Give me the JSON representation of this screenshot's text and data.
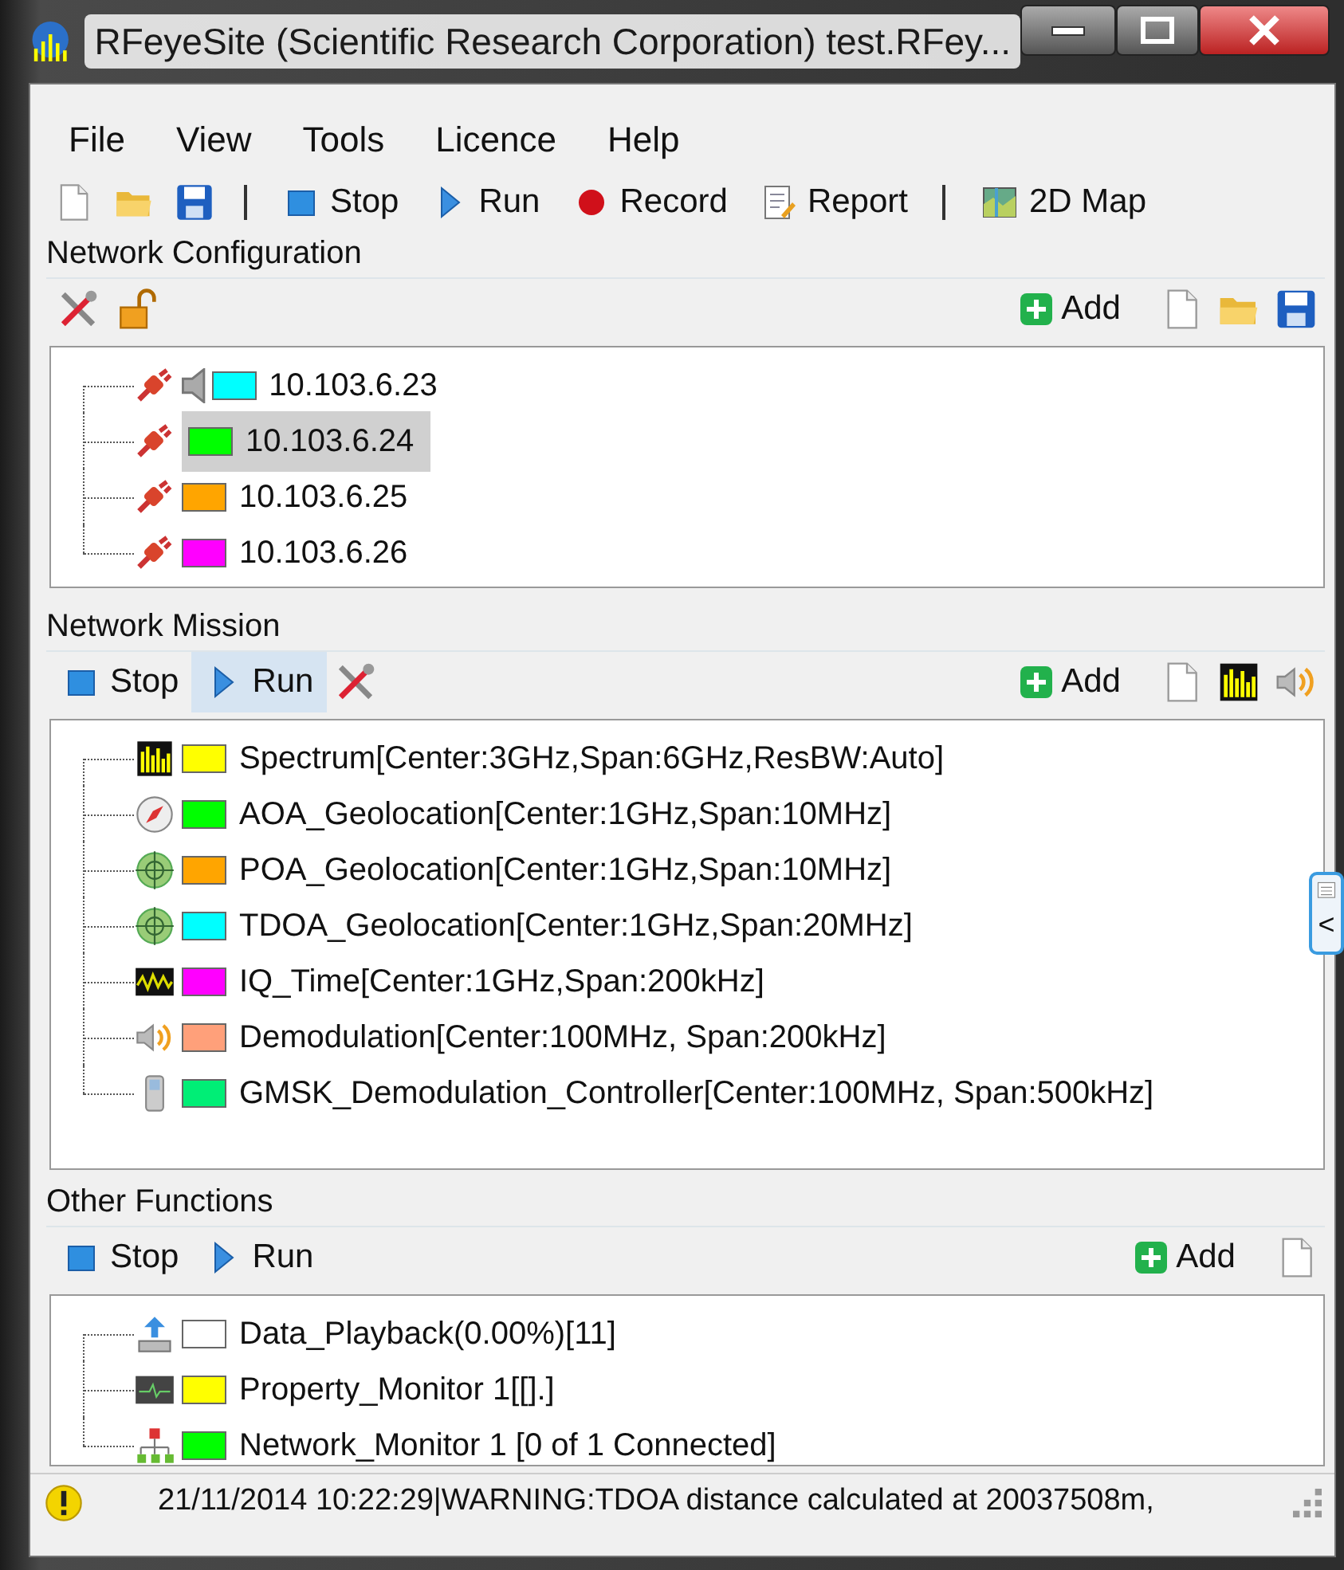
{
  "window": {
    "title": "RFeyeSite (Scientific Research Corporation) test.RFey..."
  },
  "menu": [
    "File",
    "View",
    "Tools",
    "Licence",
    "Help"
  ],
  "toolbar": [
    {
      "kind": "new"
    },
    {
      "kind": "open"
    },
    {
      "kind": "save"
    },
    {
      "kind": "separator"
    },
    {
      "kind": "stop",
      "label": "Stop"
    },
    {
      "kind": "run",
      "label": "Run"
    },
    {
      "kind": "record",
      "label": "Record"
    },
    {
      "kind": "report",
      "label": "Report"
    },
    {
      "kind": "separator"
    },
    {
      "kind": "map",
      "label": "2D Map"
    }
  ],
  "network_configuration": {
    "title": "Network Configuration",
    "left_tools": [
      {
        "kind": "tools"
      },
      {
        "kind": "unlock"
      }
    ],
    "add_label": "Add",
    "right_tools": [
      {
        "kind": "new"
      },
      {
        "kind": "open"
      },
      {
        "kind": "save"
      }
    ],
    "items": [
      {
        "kind": "plug",
        "label": "10.103.6.23",
        "color": "#00ffff",
        "selected": false,
        "audio": true
      },
      {
        "kind": "plug",
        "label": "10.103.6.24",
        "color": "#00ff00",
        "selected": true,
        "audio": false
      },
      {
        "kind": "plug",
        "label": "10.103.6.25",
        "color": "#ffa500",
        "selected": false,
        "audio": false
      },
      {
        "kind": "plug",
        "label": "10.103.6.26",
        "color": "#ff00ff",
        "selected": false,
        "audio": false
      }
    ]
  },
  "network_mission": {
    "title": "Network Mission",
    "actions": [
      {
        "kind": "stop",
        "label": "Stop",
        "selected": false
      },
      {
        "kind": "run",
        "label": "Run",
        "selected": true
      }
    ],
    "left_tools": [
      {
        "kind": "tools"
      }
    ],
    "add_label": "Add",
    "right_tools": [
      {
        "kind": "new"
      },
      {
        "kind": "spectrum"
      },
      {
        "kind": "speaker"
      }
    ],
    "items": [
      {
        "kind": "spectrum",
        "label": "Spectrum[Center:3GHz,Span:6GHz,ResBW:Auto]",
        "color": "#ffff00"
      },
      {
        "kind": "compass",
        "label": "AOA_Geolocation[Center:1GHz,Span:10MHz]",
        "color": "#00ff00"
      },
      {
        "kind": "crosshair",
        "label": "POA_Geolocation[Center:1GHz,Span:10MHz]",
        "color": "#ffa500"
      },
      {
        "kind": "crosshair",
        "label": "TDOA_Geolocation[Center:1GHz,Span:20MHz]",
        "color": "#00ffff"
      },
      {
        "kind": "waveform",
        "label": "IQ_Time[Center:1GHz,Span:200kHz]",
        "color": "#ff00ff"
      },
      {
        "kind": "speaker",
        "label": "Demodulation[Center:100MHz, Span:200kHz]",
        "color": "#ffa07a"
      },
      {
        "kind": "phone",
        "label": "GMSK_Demodulation_Controller[Center:100MHz, Span:500kHz]",
        "color": "#00ee76"
      }
    ]
  },
  "other_functions": {
    "title": "Other Functions",
    "actions": [
      {
        "kind": "stop",
        "label": "Stop",
        "selected": false
      },
      {
        "kind": "run",
        "label": "Run",
        "selected": false
      }
    ],
    "add_label": "Add",
    "right_tools": [
      {
        "kind": "new"
      }
    ],
    "items": [
      {
        "kind": "upload",
        "label": "Data_Playback(0.00%)[11]",
        "color": "#ffffff"
      },
      {
        "kind": "monitor",
        "label": "Property_Monitor 1[[].]",
        "color": "#ffff00"
      },
      {
        "kind": "network",
        "label": "Network_Monitor 1 [0 of 1 Connected]",
        "color": "#00ff00"
      }
    ]
  },
  "side_tab": {
    "label": "<"
  },
  "status_bar": {
    "message": "21/11/2014 10:22:29|WARNING:TDOA distance calculated at 20037508m,"
  }
}
